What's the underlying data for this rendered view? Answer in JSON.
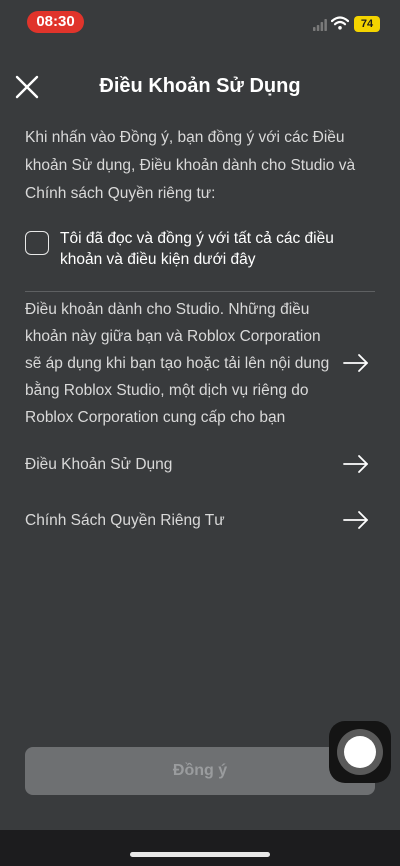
{
  "status_bar": {
    "time": "08:30",
    "battery": "74",
    "signal_icon": "cellular-signal-icon",
    "wifi_icon": "wifi-icon"
  },
  "header": {
    "title": "Điều Khoản Sử Dụng",
    "close_icon": "close-icon"
  },
  "intro": {
    "text": "Khi nhấn vào Đồng ý, bạn đồng ý với các Điều khoản Sử dụng, Điều khoản dành cho Studio và Chính sách Quyền riêng tư:"
  },
  "agreement": {
    "checked": false,
    "label": "Tôi đã đọc và đồng ý với tất cả các điều khoản và điều kiện dưới đây"
  },
  "links": [
    {
      "text": "Điều khoản dành cho Studio. Những điều khoản này giữa bạn và Roblox Corporation sẽ áp dụng khi bạn tạo hoặc tải lên nội dung bằng Roblox Studio, một dịch vụ riêng do Roblox Corporation cung cấp cho bạn",
      "icon": "arrow-right-icon"
    },
    {
      "text": "Điều Khoản Sử Dụng",
      "icon": "arrow-right-icon"
    },
    {
      "text": "Chính Sách Quyền Riêng Tư",
      "icon": "arrow-right-icon"
    }
  ],
  "footer": {
    "agree_button": "Đồng ý",
    "agree_button_enabled": false
  },
  "colors": {
    "background": "#393b3d",
    "status_time_bg": "#e0342b",
    "battery_bg": "#f4d400",
    "button_disabled_bg": "#6e7072"
  }
}
